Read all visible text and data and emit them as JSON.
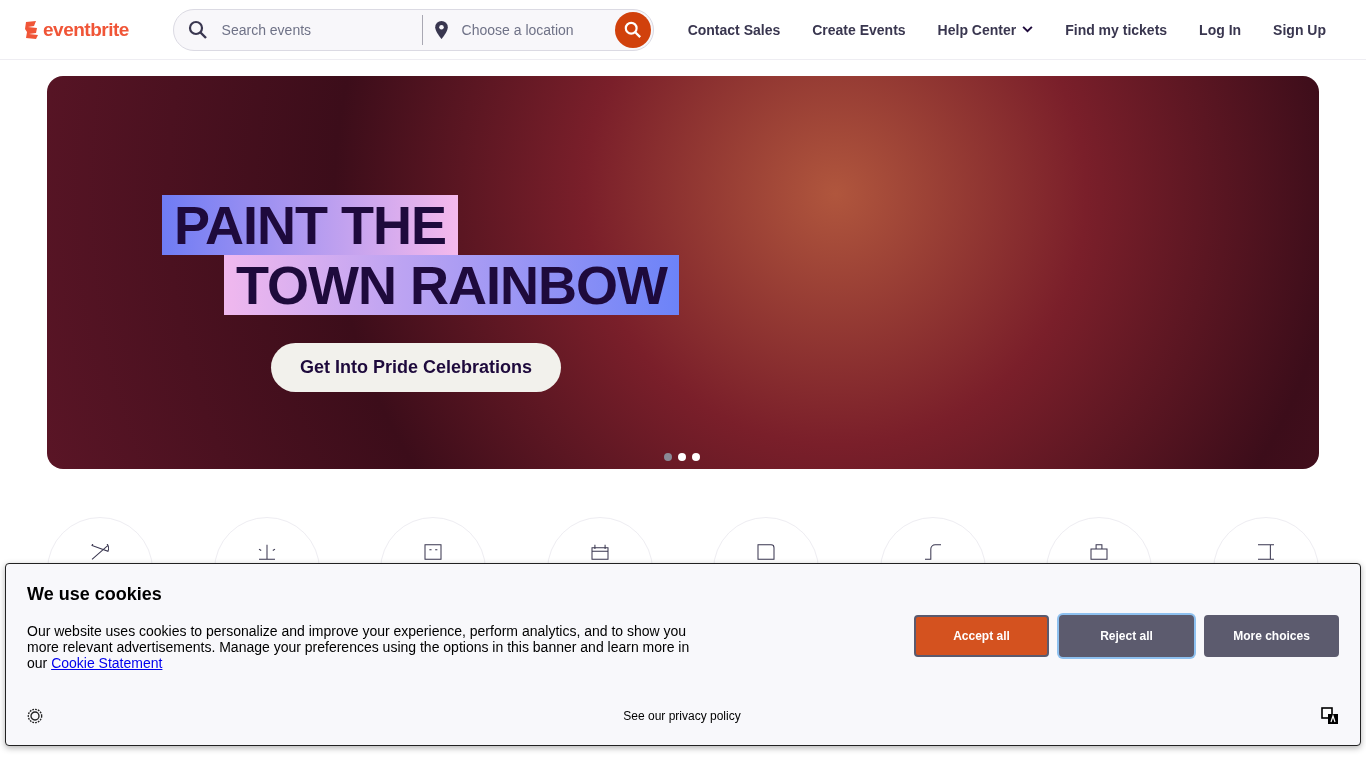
{
  "header": {
    "logo": "eventbrite",
    "search": {
      "placeholder": "Search events"
    },
    "location": {
      "placeholder": "Choose a location"
    },
    "nav": [
      {
        "label": "Contact Sales",
        "dropdown": false
      },
      {
        "label": "Create Events",
        "dropdown": false
      },
      {
        "label": "Help Center",
        "dropdown": true
      },
      {
        "label": "Find my tickets",
        "dropdown": false
      },
      {
        "label": "Log In",
        "dropdown": false
      },
      {
        "label": "Sign Up",
        "dropdown": false
      }
    ]
  },
  "hero": {
    "headline_lines": [
      "PAINT THE",
      "TOWN RAINBOW"
    ],
    "button": "Get Into Pride Celebrations",
    "dots": [
      {
        "selected": true
      },
      {
        "selected": false
      },
      {
        "selected": false
      }
    ]
  },
  "categories": [
    {
      "kind": "music"
    },
    {
      "kind": "nightlife"
    },
    {
      "kind": "arts"
    },
    {
      "kind": "holidays"
    },
    {
      "kind": "dating"
    },
    {
      "kind": "hobbies"
    },
    {
      "kind": "business"
    },
    {
      "kind": "food"
    }
  ],
  "cookie_banner": {
    "title": "We use cookies",
    "text": "Our website uses cookies to personalize and improve your experience, perform analytics, and to show you more relevant advertisements. Manage your preferences using the options in this banner and learn more in our",
    "link": "Cookie Statement",
    "buttons": [
      {
        "label": "Accept all",
        "kind": "primary",
        "focused": false
      },
      {
        "label": "Reject all",
        "kind": "secondary",
        "focused": true
      },
      {
        "label": "More choices",
        "kind": "secondary",
        "focused": false
      }
    ],
    "privacy_link": "See our privacy policy"
  }
}
